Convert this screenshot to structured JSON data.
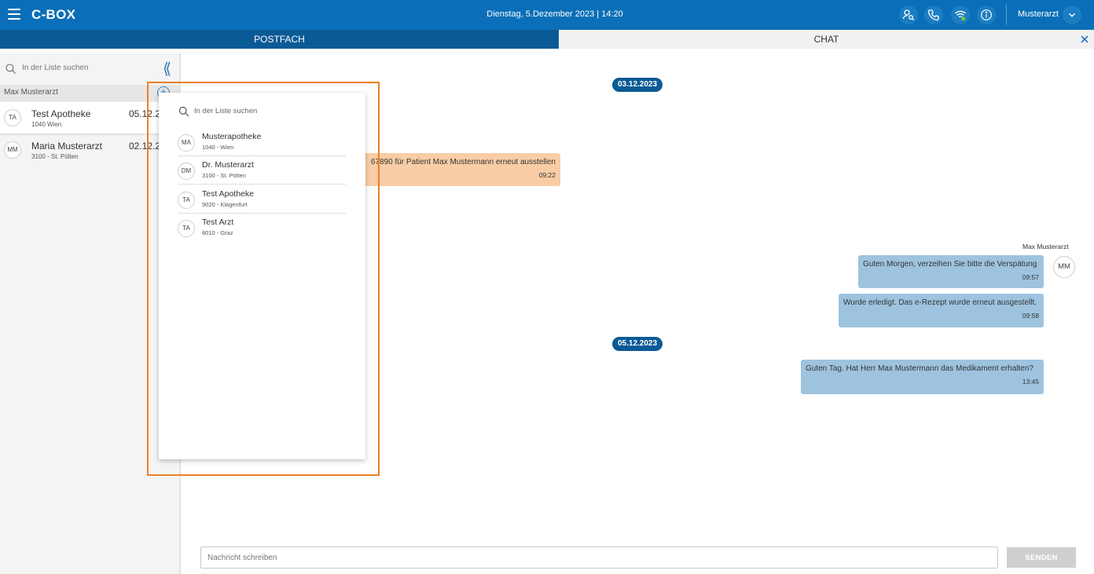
{
  "app": {
    "title": "C-BOX",
    "datetime": "Dienstag, 5.Dezember 2023 | 14:20",
    "user": "Musterarzt"
  },
  "icons": {
    "menu": "hamburger-menu-icon",
    "search_person": "person-search-icon",
    "phone": "phone-icon",
    "connection": "wifi-status-icon",
    "info": "info-icon",
    "chevron": "chevron-down-icon",
    "close": "close-icon",
    "collapse": "double-chevron-left-icon",
    "add": "add-circle-icon"
  },
  "tabs": {
    "postfach": "POSTFACH",
    "chat": "CHAT"
  },
  "sidebar": {
    "search_placeholder": "In der Liste suchen",
    "collapse_glyph": "⟪",
    "group_header": "Max Musterarzt",
    "add_glyph": "+",
    "contacts": [
      {
        "initials": "TA",
        "name": "Test Apotheke",
        "sub": "1040 Wien",
        "date": "05.12.2"
      },
      {
        "initials": "MM",
        "name": "Maria Musterarzt",
        "sub": "3100 - St. Pölten",
        "date": "02.12.2"
      }
    ]
  },
  "chat": {
    "dates": [
      "03.12.2023",
      "05.12.2023"
    ],
    "incoming": {
      "text": "67890 für Patient Max Mustermann erneut ausstellen",
      "time": "09:22"
    },
    "sender_name": "Max Musterarzt",
    "sender_initials": "MM",
    "outgoing": [
      {
        "text": "Guten Morgen, verzeihen Sie bitte die Verspätung",
        "time": "09:57"
      },
      {
        "text": "Wurde erledigt. Das e-Rezept wurde erneut ausgestellt.",
        "time": "09:58"
      },
      {
        "text": "Guten Tag. Hat Herr Max Mustermann das Medikament erhalten?",
        "time": "13:45"
      }
    ]
  },
  "compose": {
    "placeholder": "Nachricht schreiben",
    "send_label": "SENDEN"
  },
  "dropdown": {
    "search_placeholder": "In der Liste suchen",
    "items": [
      {
        "initials": "MA",
        "name": "Musterapotheke",
        "sub": "1040 - Wien"
      },
      {
        "initials": "DM",
        "name": "Dr. Musterarzt",
        "sub": "3100 - St. Pölten"
      },
      {
        "initials": "TA",
        "name": "Test Apotheke",
        "sub": "9020 - Klagenfurt"
      },
      {
        "initials": "TA",
        "name": "Test Arzt",
        "sub": "8010 - Graz"
      }
    ]
  },
  "colors": {
    "primary": "#0a6fb8",
    "tab_active": "#0a5a96",
    "bubble_outgoing": "#9ec3df",
    "bubble_incoming": "#f9cda5",
    "highlight": "#e8802a",
    "status_ok": "#7fc241"
  }
}
